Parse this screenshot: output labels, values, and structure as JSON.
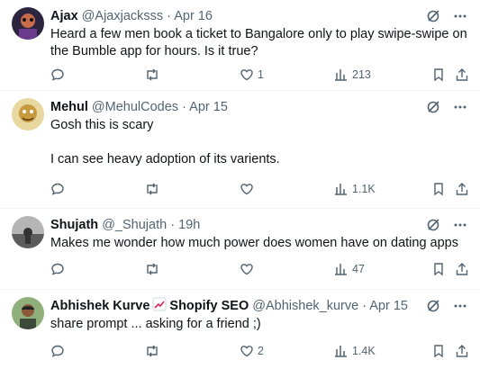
{
  "tweets": [
    {
      "name": "Ajax",
      "handle": "@Ajaxjacksss",
      "time": "Apr 16",
      "lines": [
        "Heard a few men book a ticket to Bangalore only to play swipe-swipe on",
        "the Bumble app for hours. Is it true?"
      ],
      "stats": {
        "replies": "",
        "reposts": "",
        "likes": "1",
        "views": "213"
      },
      "avatar_color": "#3a2a4a"
    },
    {
      "name": "Mehul",
      "handle": "@MehulCodes",
      "time": "Apr 15",
      "lines": [
        "Gosh this is scary",
        "I can see heavy adoption of its varients."
      ],
      "stats": {
        "replies": "",
        "reposts": "",
        "likes": "",
        "views": "1.1K"
      },
      "avatar_color": "#cfa65a"
    },
    {
      "name": "Shujath",
      "handle": "@_Shujath",
      "time": "19h",
      "lines": [
        "Makes me wonder how much power does women have on dating apps"
      ],
      "stats": {
        "replies": "",
        "reposts": "",
        "likes": "",
        "views": "47"
      },
      "avatar_color": "#8a8a8a"
    },
    {
      "name": "Abhishek Kurve",
      "name_suffix": "Shopify SEO",
      "handle": "@Abhishek_kurve",
      "time": "Apr 15",
      "lines": [
        "share prompt ... asking for a friend ;)"
      ],
      "stats": {
        "replies": "",
        "reposts": "",
        "likes": "2",
        "views": "1.4K"
      },
      "avatar_color": "#6b8f5a"
    }
  ],
  "separator": "·",
  "icons": {
    "grok": "grok-icon",
    "more": "more-icon",
    "reply": "reply-icon",
    "repost": "repost-icon",
    "like": "like-icon",
    "views": "views-icon",
    "bookmark": "bookmark-icon",
    "share": "share-icon",
    "badge": "chart-up-emoji-icon"
  },
  "colors": {
    "text": "#0f1419",
    "muted": "#536471",
    "border": "#eff3f4"
  }
}
